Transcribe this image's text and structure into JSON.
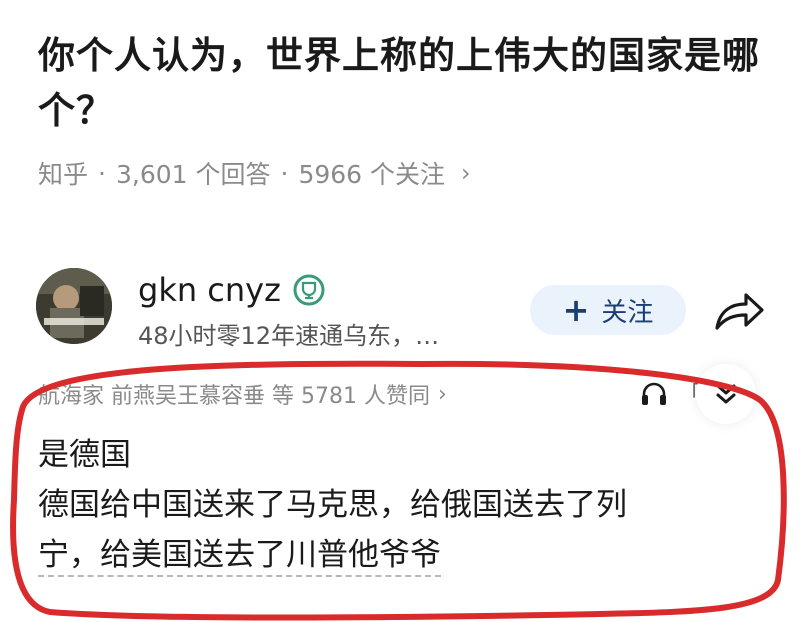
{
  "question": {
    "title": "你个人认为，世界上称的上伟大的国家是哪个？",
    "source": "知乎",
    "answers": "3,601 个回答",
    "followers": "5966 个关注"
  },
  "answer": {
    "author_name": "gkn cnyz",
    "author_bio": "48小时零12年速通乌东，…",
    "follow_label": "关注",
    "voters": "航海家 前燕吴王慕容垂 等 5781 人赞同",
    "bracket": "「",
    "lines": [
      "是德国",
      "德国给中国送来了马克思，给俄国送去了列",
      "宁，给美国送去了川普他爷爷"
    ]
  },
  "colors": {
    "annotation": "#d92b2b",
    "follow_bg": "#eaf2fb",
    "follow_text": "#1c3f73",
    "badge": "#3a9a7a"
  },
  "icons": [
    "chevron-right-icon",
    "badge-icon",
    "plus-icon",
    "share-icon",
    "headphones-icon",
    "double-chevron-down-icon"
  ]
}
